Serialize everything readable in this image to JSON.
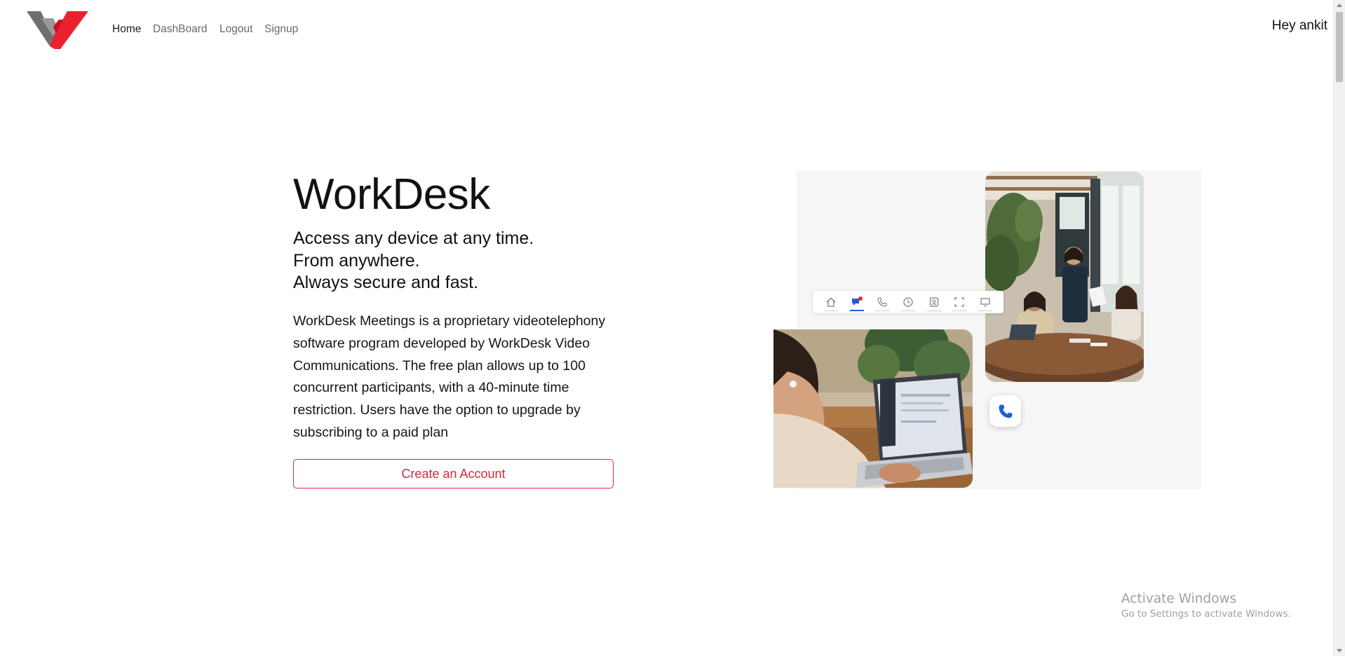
{
  "navbar": {
    "logo_icon": "workdesk-w-logo",
    "links": [
      {
        "label": "Home",
        "active": true
      },
      {
        "label": "DashBoard",
        "active": false
      },
      {
        "label": "Logout",
        "active": false
      },
      {
        "label": "Signup",
        "active": false
      }
    ],
    "greeting": "Hey ankit"
  },
  "hero": {
    "title": "WorkDesk",
    "tagline": [
      "Access any device at any time.",
      "From anywhere.",
      "Always secure and fast."
    ],
    "description": "WorkDesk Meetings is a proprietary videotelephony software program developed by WorkDesk Video Communications. The free plan allows up to 100 concurrent participants, with a 40-minute time restriction. Users have the option to upgrade by subscribing to a paid plan",
    "cta_label": "Create an Account",
    "accent_color": "#d6283e"
  },
  "illustration": {
    "toolbar_icons": [
      "home-icon",
      "chat-icon",
      "phone-icon",
      "clock-icon",
      "contact-icon",
      "screen-share-icon",
      "monitor-icon"
    ],
    "active_toolbar_icon": "chat-icon",
    "call_icon": "phone-call-icon",
    "photos": [
      "meeting-photo",
      "laptop-photo"
    ]
  },
  "watermark": {
    "title": "Activate Windows",
    "subtitle": "Go to Settings to activate Windows."
  }
}
